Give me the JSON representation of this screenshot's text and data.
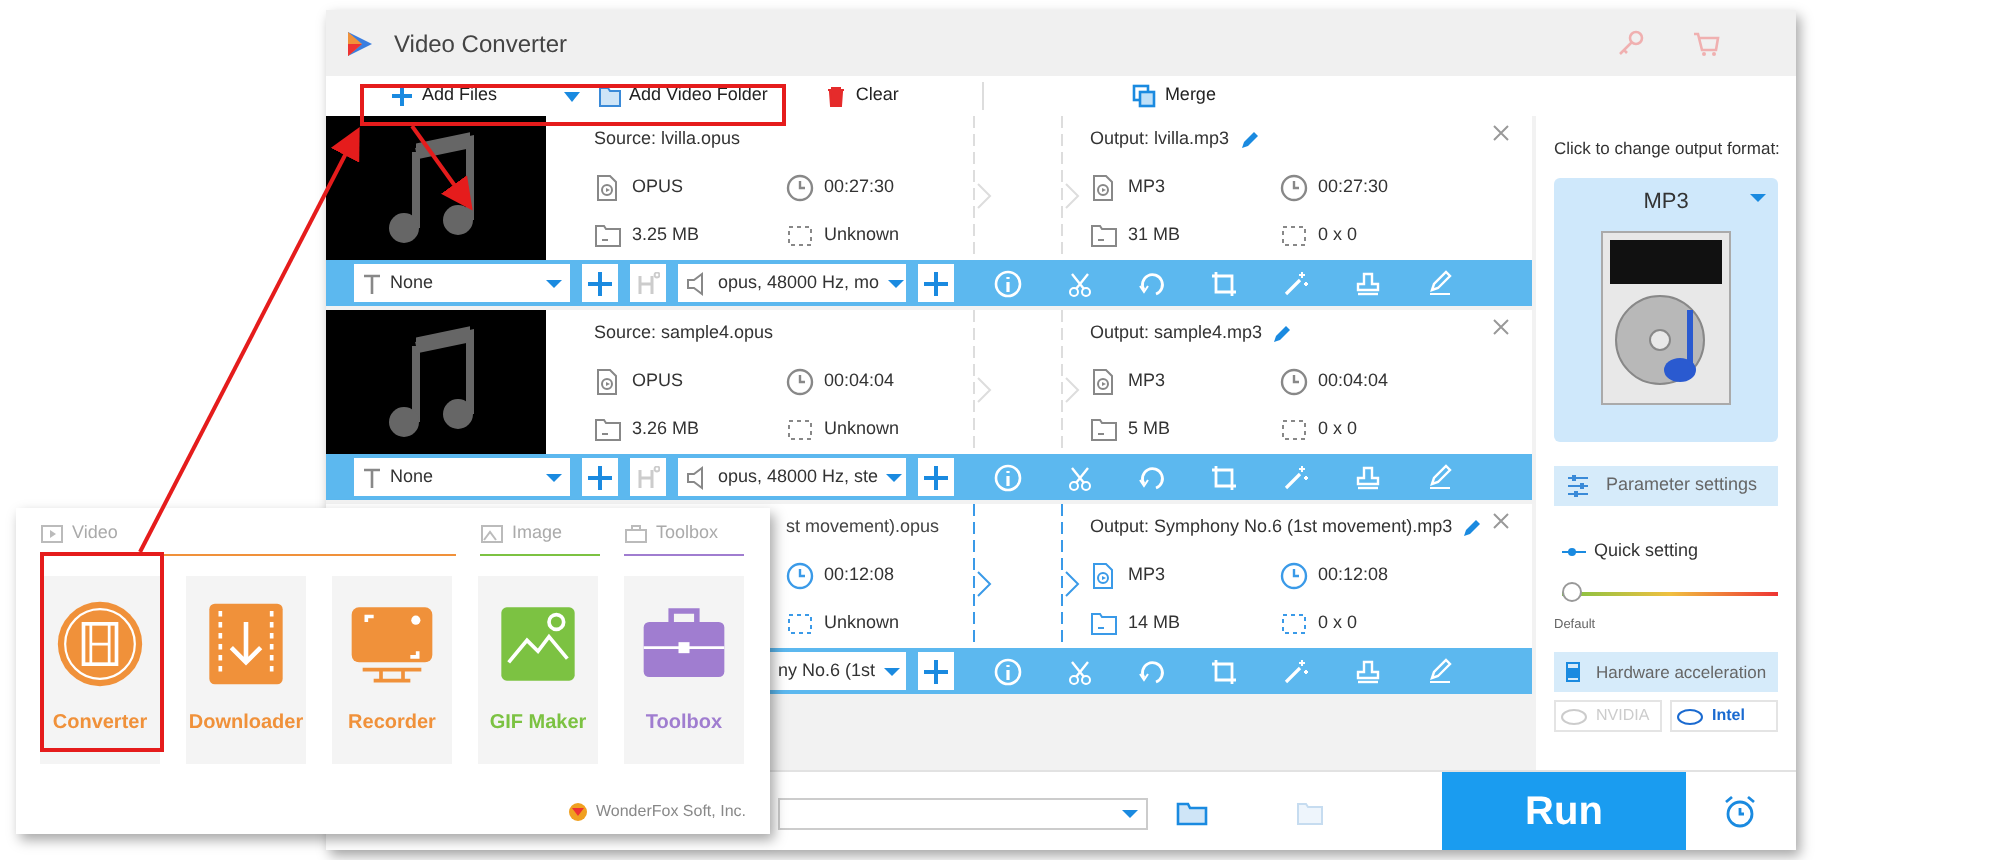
{
  "window": {
    "title": "Video Converter"
  },
  "toolbar": [
    {
      "kind": "add",
      "label": "Add Files"
    },
    {
      "kind": "folder",
      "label": "Add Video Folder"
    },
    {
      "kind": "clear",
      "label": "Clear"
    },
    {
      "kind": "merge",
      "label": "Merge"
    }
  ],
  "files": [
    {
      "selected": false,
      "covered": false,
      "source": "Source: lvilla.opus",
      "source_format": "OPUS",
      "source_duration": "00:27:30",
      "source_size": "3.25 MB",
      "source_resolution": "Unknown",
      "output": "Output: lvilla.mp3",
      "output_format": "MP3",
      "output_duration": "00:27:30",
      "output_size": "31 MB",
      "output_resolution": "0 x 0",
      "subtitle": "None",
      "audio": "opus, 48000 Hz, mo"
    },
    {
      "selected": false,
      "covered": false,
      "source": "Source: sample4.opus",
      "source_format": "OPUS",
      "source_duration": "00:04:04",
      "source_size": "3.26 MB",
      "source_resolution": "Unknown",
      "output": "Output: sample4.mp3",
      "output_format": "MP3",
      "output_duration": "00:04:04",
      "output_size": "5 MB",
      "output_resolution": "0 x 0",
      "subtitle": "None",
      "audio": "opus, 48000 Hz, ste"
    },
    {
      "selected": true,
      "covered": true,
      "source": "st movement).opus",
      "source_duration": "00:12:08",
      "source_resolution": "Unknown",
      "output": "Output: Symphony No.6 (1st movement).mp3",
      "output_format": "MP3",
      "output_duration": "00:12:08",
      "output_size": "14 MB",
      "output_resolution": "0 x 0",
      "audio": "ny No.6 (1st"
    }
  ],
  "output_panel": {
    "hint": "Click to change output format:",
    "format": "MP3",
    "parameter_settings": "Parameter settings",
    "quick_setting": "Quick setting",
    "quality": {
      "level": 0,
      "label": "Default"
    },
    "hardware_acceleration": {
      "label": "Hardware acceleration",
      "checked": true
    },
    "encoders": [
      {
        "label": "NVIDIA",
        "disabled": true
      },
      {
        "label": "Intel",
        "disabled": false
      }
    ]
  },
  "run_button": "Run",
  "launcher": {
    "sections": [
      {
        "label": "Video",
        "color": "#f0913a"
      },
      {
        "label": "Image",
        "color": "#7cc242"
      },
      {
        "label": "Toolbox",
        "color": "#a07dd0"
      }
    ],
    "tools": [
      {
        "kind": "converter",
        "label": "Converter",
        "color": "#f0913a"
      },
      {
        "kind": "downloader",
        "label": "Downloader",
        "color": "#f0913a"
      },
      {
        "kind": "recorder",
        "label": "Recorder",
        "color": "#f0913a"
      },
      {
        "kind": "gif",
        "label": "GIF Maker",
        "color": "#7cc242"
      },
      {
        "kind": "toolbox",
        "label": "Toolbox",
        "color": "#a07dd0"
      }
    ],
    "footer": "WonderFox Soft, Inc."
  }
}
